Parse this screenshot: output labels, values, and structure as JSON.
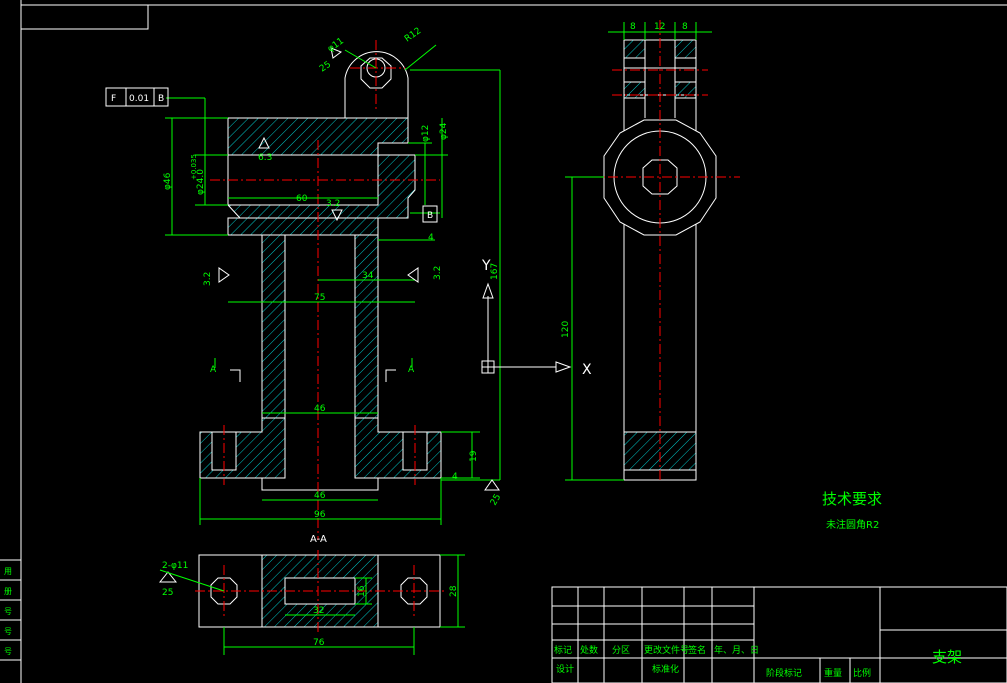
{
  "drawing": {
    "title": "支架",
    "tech_requirements_title": "技术要求",
    "tech_requirements_note": "未注圆角R2",
    "section_label": "A-A",
    "section_mark_left": "A",
    "section_mark_right": "A",
    "ucs_y": "Y",
    "ucs_x": "X"
  },
  "colors": {
    "background": "#000000",
    "outline": "#ffffff",
    "dimension": "#00ff00",
    "centerline": "#ff0000",
    "hatch": "#00c8c8"
  },
  "dimensions": {
    "top_dia": "φ11",
    "top_radius": "R12",
    "top_ra": "25",
    "tol_f": "F",
    "tol_value": "0.01",
    "tol_datum": "B",
    "bore_outer": "φ46",
    "bore_inner": "φ24.0",
    "bore_tol": "+0.035",
    "ra_bore": "6.3",
    "width_60": "60",
    "ra_mid": "3.2",
    "dia_12": "φ12",
    "dia_24": "φ24",
    "datum_b": "B",
    "dim_4": "4",
    "ra_left": "3.2",
    "ra_right": "3.2",
    "dim_34": "34",
    "dim_75": "75",
    "dim_46_mid": "46",
    "dim_46_bot": "46",
    "dim_96": "96",
    "dim_19": "19",
    "dim_4_bot": "4",
    "ra_bottom": "25",
    "height_167": "167",
    "side_8_left": "8",
    "side_12": "12",
    "side_8_right": "8",
    "side_120": "120",
    "sec_holes": "2-φ11",
    "sec_ra": "25",
    "sec_32": "32",
    "sec_16": "16",
    "sec_28": "28",
    "sec_76": "76"
  },
  "title_block": {
    "row1": [
      "标记",
      "处数",
      "分区",
      "更改文件号",
      "签名",
      "年、月、日"
    ],
    "row2": [
      "设计",
      "",
      "",
      "标准化"
    ],
    "stage_label": "阶段标记",
    "weight_label": "重量",
    "scale_label": "比例"
  },
  "left_strip": [
    "用",
    "册",
    "号",
    "号",
    "号"
  ]
}
